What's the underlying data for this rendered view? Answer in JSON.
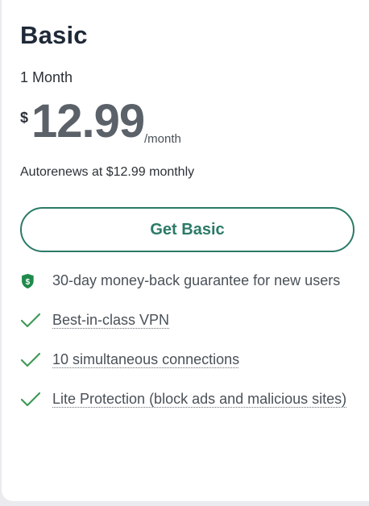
{
  "plan": {
    "name": "Basic",
    "duration": "1 Month",
    "currency_symbol": "$",
    "price": "12.99",
    "period": "/month",
    "autorenew_text": "Autorenews at $12.99 monthly",
    "cta_label": "Get Basic"
  },
  "features": [
    {
      "icon": "shield-dollar-icon",
      "text": "30-day money-back guarantee for new users",
      "dotted": false
    },
    {
      "icon": "check-icon",
      "text": "Best-in-class VPN",
      "dotted": true
    },
    {
      "icon": "check-icon",
      "text": "10 simultaneous connections",
      "dotted": true
    },
    {
      "icon": "check-icon",
      "text": "Lite Protection (block ads and malicious sites)",
      "dotted": true
    }
  ],
  "colors": {
    "accent": "#2b7a67",
    "check": "#3f9a58",
    "shield": "#1f8a4c",
    "text_dark": "#1f2937",
    "text_muted": "#4a5158",
    "price": "#5b6168"
  }
}
